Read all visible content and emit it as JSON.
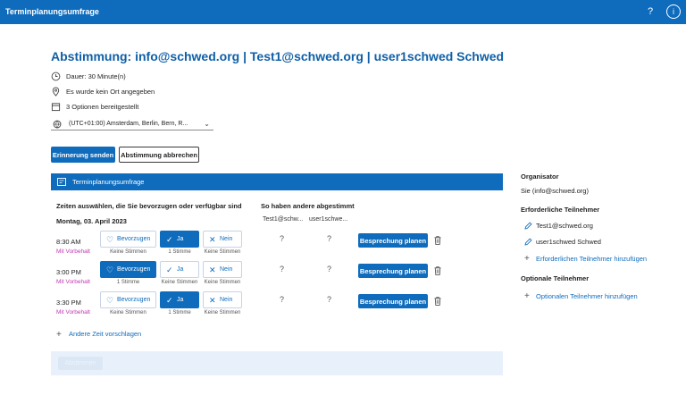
{
  "app": {
    "title": "Terminplanungsumfrage",
    "help_glyph": "?",
    "info_glyph": "i"
  },
  "poll": {
    "title": "Abstimmung: info@schwed.org | Test1@schwed.org | user1schwed Schwed",
    "duration": "Dauer: 30 Minute(n)",
    "location": "Es wurde kein Ort angegeben",
    "options": "3 Optionen bereitgestellt",
    "timezone": "(UTC+01:00) Amsterdam, Berlin, Bern, R..."
  },
  "actions": {
    "remind": "Erinnerung senden",
    "cancel": "Abstimmung abbrechen"
  },
  "panel": {
    "header": "Terminplanungsumfrage",
    "left_heading": "Zeiten auswählen, die Sie bevorzugen oder verfügbar sind",
    "right_heading": "So haben andere abgestimmt",
    "date": "Montag, 03. April 2023",
    "participants": [
      "Test1@schw...",
      "user1schwe..."
    ],
    "prefer_label": "Bevorzugen",
    "yes_label": "Ja",
    "no_label": "Nein",
    "plan_label": "Besprechung planen",
    "rows": [
      {
        "time": "8:30 AM",
        "tentative": "Mit Vorbehalt",
        "prefer_count": "Keine Stimmen",
        "yes_count": "1 Stimme",
        "no_count": "Keine Stimmen",
        "votes": [
          "?",
          "?"
        ],
        "selected": "yes"
      },
      {
        "time": "3:00 PM",
        "tentative": "Mit Vorbehalt",
        "prefer_count": "1 Stimme",
        "yes_count": "Keine Stimmen",
        "no_count": "Keine Stimmen",
        "votes": [
          "?",
          "?"
        ],
        "selected": "prefer"
      },
      {
        "time": "3:30 PM",
        "tentative": "Mit Vorbehalt",
        "prefer_count": "Keine Stimmen",
        "yes_count": "1 Stimme",
        "no_count": "Keine Stimmen",
        "votes": [
          "?",
          "?"
        ],
        "selected": "yes"
      }
    ],
    "suggest": "Andere Zeit vorschlagen",
    "submit": "Abstimmen"
  },
  "sidebar": {
    "organizer_heading": "Organisator",
    "organizer": "Sie (info@schwed.org)",
    "required_heading": "Erforderliche Teilnehmer",
    "required": [
      "Test1@schwed.org",
      "user1schwed Schwed"
    ],
    "add_required": "Erforderlichen Teilnehmer hinzufügen",
    "optional_heading": "Optionale Teilnehmer",
    "add_optional": "Optionalen Teilnehmer hinzufügen"
  },
  "colors": {
    "primary": "#0f6cbd",
    "title": "#0f5fa8",
    "tentative": "#c239b3",
    "footer": "#e8f1fb"
  }
}
